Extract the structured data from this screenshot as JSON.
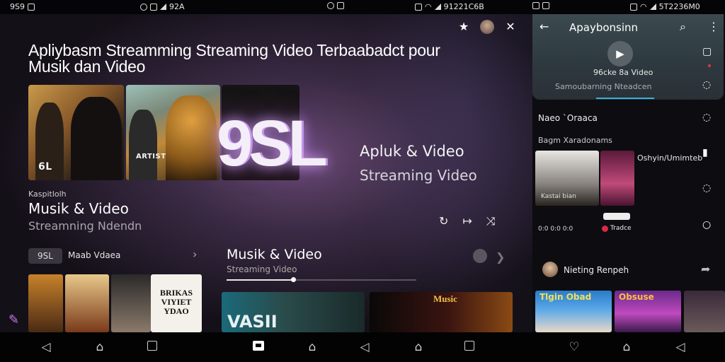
{
  "status_bar": {
    "segment_1_time": "9S9",
    "segment_2_time": "92A",
    "segment_4_time": "91221C6B",
    "segment_5_time": "5T2236M0"
  },
  "main": {
    "hero": {
      "title_line1": "Apliybasm Streamming Streaming Video Terbaabadct pour",
      "title_line2": "Musik dan Video",
      "logo_text": "9SL",
      "side_line1": "Apluk & Video",
      "side_line2": "Streaming Video",
      "poster_label_1": "6L",
      "poster_label_2": "ARTIST"
    },
    "featured": {
      "kicker": "Kaspitlolh",
      "title": "Musik & Video",
      "subtitle": "Streamning Ndendn"
    },
    "row1": {
      "chip": "9SL",
      "label": "Maab Vdaea"
    },
    "row2": {
      "title": "Musik & Video",
      "subtitle": "Streaming Video",
      "progress_fraction": 0.35
    },
    "thumbnails": {
      "t4_text": "BRIKAS VIYIET YDAO",
      "t5_text": "VASII",
      "t6_text": "Music"
    }
  },
  "right_panel": {
    "header_title": "Apaybonsinn",
    "now_playing_label": "96cke 8a Video",
    "now_playing_note": "Samoubarning Nteadcen",
    "section_title": "Naeo `Oraaca",
    "subsection_title": "Bagm  Xaradonams",
    "side_label": "Oshyin/Umimteb",
    "tile_caption": "Kastai bian",
    "tile_meta": "0:0 0:0    0:0",
    "chip_label": "Tradce",
    "follow_label": "Nieting Renpeh",
    "bottom_tile_1": "Tlgin Obad",
    "bottom_tile_2": "Obsuse"
  },
  "colors": {
    "accent": "#c57be8",
    "progress_accent": "#3ab0d8",
    "live_dot": "#d83a3a"
  }
}
